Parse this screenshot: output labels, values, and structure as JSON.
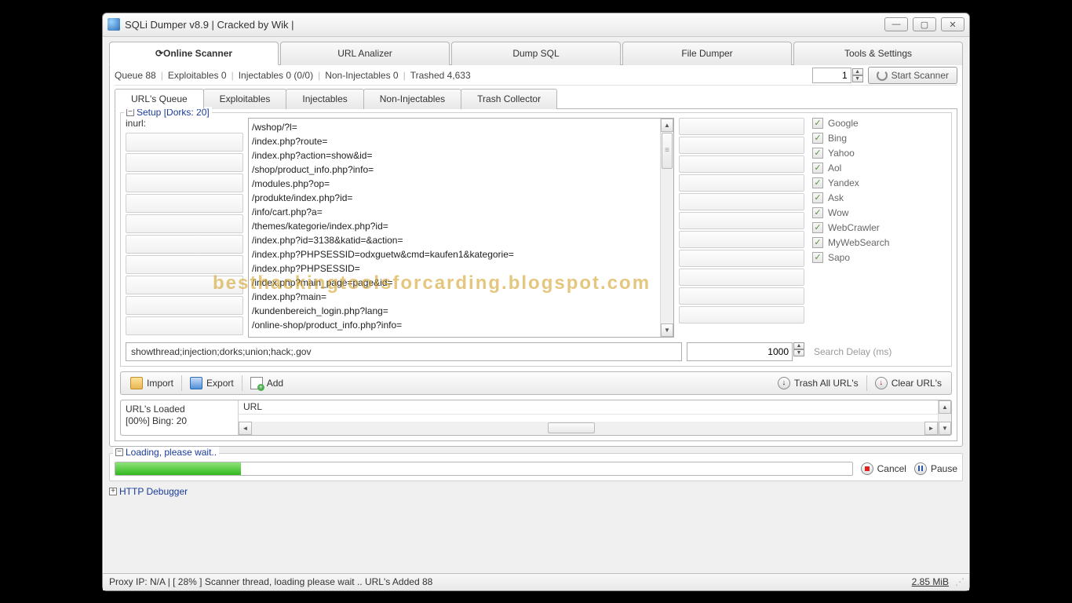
{
  "window": {
    "title": "SQLi Dumper v8.9 | Cracked by Wik |"
  },
  "main_tabs": [
    "Online Scanner",
    "URL Analizer",
    "Dump SQL",
    "File Dumper",
    "Tools & Settings"
  ],
  "active_main_tab": 0,
  "queue_stats": {
    "queue": "Queue 88",
    "exploitables": "Exploitables 0",
    "injectables": "Injectables 0 (0/0)",
    "non_injectables": "Non-Injectables 0",
    "trashed": "Trashed 4,633"
  },
  "threads_spinner": "1",
  "start_scanner_label": "Start Scanner",
  "sub_tabs": [
    "URL's Queue",
    "Exploitables",
    "Injectables",
    "Non-Injectables",
    "Trash Collector"
  ],
  "active_sub_tab": 0,
  "setup": {
    "legend": "Setup [Dorks: 20]",
    "inurl_label": "inurl:",
    "dorks": [
      "/wshop/?l=",
      "/index.php?route=",
      "/index.php?action=show&id=",
      "/shop/product_info.php?info=",
      "/modules.php?op=",
      "/produkte/index.php?id=",
      "/info/cart.php?a=",
      "/themes/kategorie/index.php?id=",
      "/index.php?id=3138&katid=&action=",
      "/index.php?PHPSESSID=odxguetw&cmd=kaufen1&kategorie=",
      "/index.php?PHPSESSID=",
      "/index.php?main_page=page&id=",
      "/index.php?main=",
      "/kundenbereich_login.php?lang=",
      "/online-shop/product_info.php?info="
    ],
    "engines": [
      "Google",
      "Bing",
      "Yahoo",
      "Aol",
      "Yandex",
      "Ask",
      "Wow",
      "WebCrawler",
      "MyWebSearch",
      "Sapo"
    ],
    "filter_value": "showthread;injection;dorks;union;hack;.gov",
    "delay_value": "1000",
    "delay_placeholder": "Search Delay (ms)"
  },
  "toolbar": {
    "import": "Import",
    "export": "Export",
    "add": "Add",
    "trash_all": "Trash All URL's",
    "clear": "Clear URL's"
  },
  "url_list": {
    "loaded_label": "URL's Loaded",
    "loaded_status": "[00%] Bing: 20",
    "header": "URL"
  },
  "loading": {
    "legend": "Loading, please wait..",
    "cancel": "Cancel",
    "pause": "Pause"
  },
  "debugger_label": "HTTP Debugger",
  "statusbar": {
    "left": "Proxy IP: N/A   |   [ 28% ] Scanner thread, loading please wait .. URL's Added 88",
    "right": "2.85 MiB"
  },
  "watermark": "besthackingtoolsforcarding.blogspot.com"
}
